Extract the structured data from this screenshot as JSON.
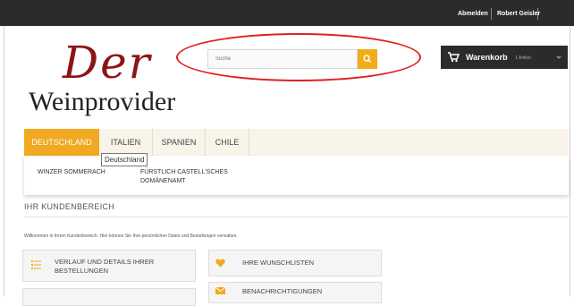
{
  "header": {
    "logout_label": "Abmelden",
    "user_name": "Robert Geisler"
  },
  "logo": {
    "line1": "Der",
    "line2": "Weinprovider"
  },
  "search": {
    "placeholder": "Suche",
    "icon": "search-icon"
  },
  "cart": {
    "label": "Warenkorb",
    "count": "1 Artikel",
    "icon": "cart-icon"
  },
  "nav": {
    "tabs": [
      {
        "label": "DEUTSCHLAND",
        "active": true
      },
      {
        "label": "ITALIEN",
        "active": false
      },
      {
        "label": "SPANIEN",
        "active": false
      },
      {
        "label": "CHILE",
        "active": false
      }
    ],
    "tooltip": "Deutschland",
    "dropdown_items": [
      {
        "label": "WINZER SOMMERACH"
      },
      {
        "line1": "FÜRSTLICH CASTELL'SCHES",
        "line2": "DOMÄNENAMT"
      }
    ]
  },
  "account": {
    "title": "IHR KUNDENBEREICH",
    "welcome": "Willkommen in Ihrem Kundenbereich. Hier können Sie Ihre persönlichen Daten und Bestellungen verwalten.",
    "tiles": [
      {
        "line1": "VERLAUF UND DETAILS IHRER",
        "line2": "BESTELLUNGEN",
        "icon": "list-icon"
      },
      {
        "label": "IHRE WUNSCHLISTEN",
        "icon": "heart-icon"
      },
      {
        "label": "BENACHRICHTIGUNGEN",
        "icon": "envelope-icon"
      }
    ]
  },
  "colors": {
    "accent": "#f0a921",
    "dark": "#2b2b2b",
    "logo_red": "#8c1616",
    "annotation_red": "#e0201e"
  }
}
